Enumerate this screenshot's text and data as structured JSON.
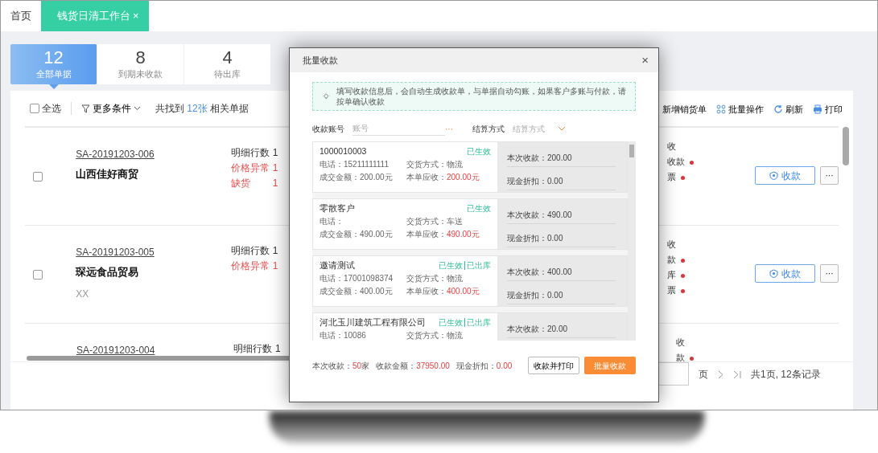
{
  "tabs": [
    {
      "label": "首页",
      "selected": false
    },
    {
      "label": "钱货日清工作台",
      "selected": true,
      "close": "×"
    }
  ],
  "stat_cards": [
    {
      "count": "12",
      "label": "全部单据",
      "selected": true
    },
    {
      "count": "8",
      "label": "到期未收款",
      "selected": false
    },
    {
      "count": "4",
      "label": "待出库",
      "selected": false
    }
  ],
  "toolbar": {
    "select_all": {
      "label": "全选",
      "checked": false
    },
    "filter": "更多条件",
    "found": {
      "prefix": "共找到",
      "count": "12张",
      "suffix": "相关单据"
    },
    "actions": [
      {
        "kind": "plain",
        "label": "新增销货单"
      },
      {
        "kind": "batch",
        "label": "批量操作"
      },
      {
        "kind": "refresh",
        "label": "刷新"
      },
      {
        "kind": "print",
        "label": "打印"
      }
    ]
  },
  "orders": [
    {
      "number": "SA-20191203-006",
      "customer": "山西佳好商贸",
      "checked": false,
      "stats": [
        {
          "label": "明细行数",
          "value": "1",
          "alert": false
        },
        {
          "label": "价格异常",
          "value": "1",
          "alert": true
        },
        {
          "label": "缺货",
          "value": "1",
          "alert": true
        }
      ],
      "status": [
        {
          "text": "收",
          "dot": false
        },
        {
          "text": "收款",
          "dot": true
        },
        {
          "text": "票",
          "dot": true
        }
      ],
      "action": "收款",
      "more": "···"
    },
    {
      "number": "SA-20191203-005",
      "customer": "琛远食品贸易",
      "note": "XX",
      "checked": false,
      "stats": [
        {
          "label": "明细行数",
          "value": "1",
          "alert": false
        },
        {
          "label": "价格异常",
          "value": "1",
          "alert": true
        }
      ],
      "status": [
        {
          "text": "收",
          "dot": false
        },
        {
          "text": "款",
          "dot": true
        },
        {
          "text": "库",
          "dot": true
        },
        {
          "text": "票",
          "dot": true
        }
      ],
      "action": "收款",
      "more": "···"
    },
    {
      "number": "SA-20191203-004",
      "stats": [
        {
          "label": "明细行数",
          "value": "1",
          "alert": false
        }
      ],
      "status": [
        {
          "text": "收",
          "dot": false
        },
        {
          "text": "款",
          "dot": true
        }
      ]
    }
  ],
  "pagination": {
    "page_label": "页",
    "summary": "共1页, 12条记录"
  },
  "dialog": {
    "title": "批量收款",
    "close": "×",
    "tip": "填写收款信息后，会自动生成收款单，与单据自动勾账，如果客户多账与付款，请按单确认收款",
    "fields": [
      {
        "kind": "picker",
        "label": "收款账号",
        "placeholder": "账号",
        "trigger": "···"
      },
      {
        "kind": "select",
        "label": "结算方式",
        "placeholder": "结算方式"
      }
    ],
    "receipts": [
      {
        "customer": "1000010003",
        "tags": [
          "已生效"
        ],
        "phone": "电话：15211111111",
        "delivery": "交货方式：物流",
        "amount": "成交金额：200.00元",
        "due_label": "本单应收：",
        "due": "200.00元",
        "receive": "本次收款：200.00",
        "discount": "现金折扣：0.00"
      },
      {
        "customer": "零散客户",
        "tags": [
          "已生效"
        ],
        "phone": "电话：",
        "delivery": "交货方式：车送",
        "amount": "成交金额：490.00元",
        "due_label": "本单应收：",
        "due": "490.00元",
        "receive": "本次收款：490.00",
        "discount": "现金折扣：0.00"
      },
      {
        "customer": "邀请测试",
        "tags": [
          "已生效",
          "已出库"
        ],
        "phone": "电话：17001098374",
        "delivery": "交货方式：物流",
        "amount": "成交金额：400.00元",
        "due_label": "本单应收：",
        "due": "400.00元",
        "receive": "本次收款：400.00",
        "discount": "现金折扣：0.00"
      },
      {
        "customer": "河北玉川建筑工程有限公司",
        "tags": [
          "已生效",
          "已出库"
        ],
        "phone": "电话：10086",
        "delivery": "交货方式：物流",
        "receive": "本次收款：20.00"
      }
    ],
    "summary": [
      {
        "label": "本次收款：",
        "value": "50",
        "unit": "家"
      },
      {
        "label": "收款金额：",
        "value": "37950.00"
      },
      {
        "label": "现金折扣：",
        "value": "0.00"
      }
    ],
    "buttons": [
      {
        "kind": "secondary",
        "label": "收款并打印"
      },
      {
        "kind": "primary",
        "label": "批量收款"
      }
    ]
  }
}
